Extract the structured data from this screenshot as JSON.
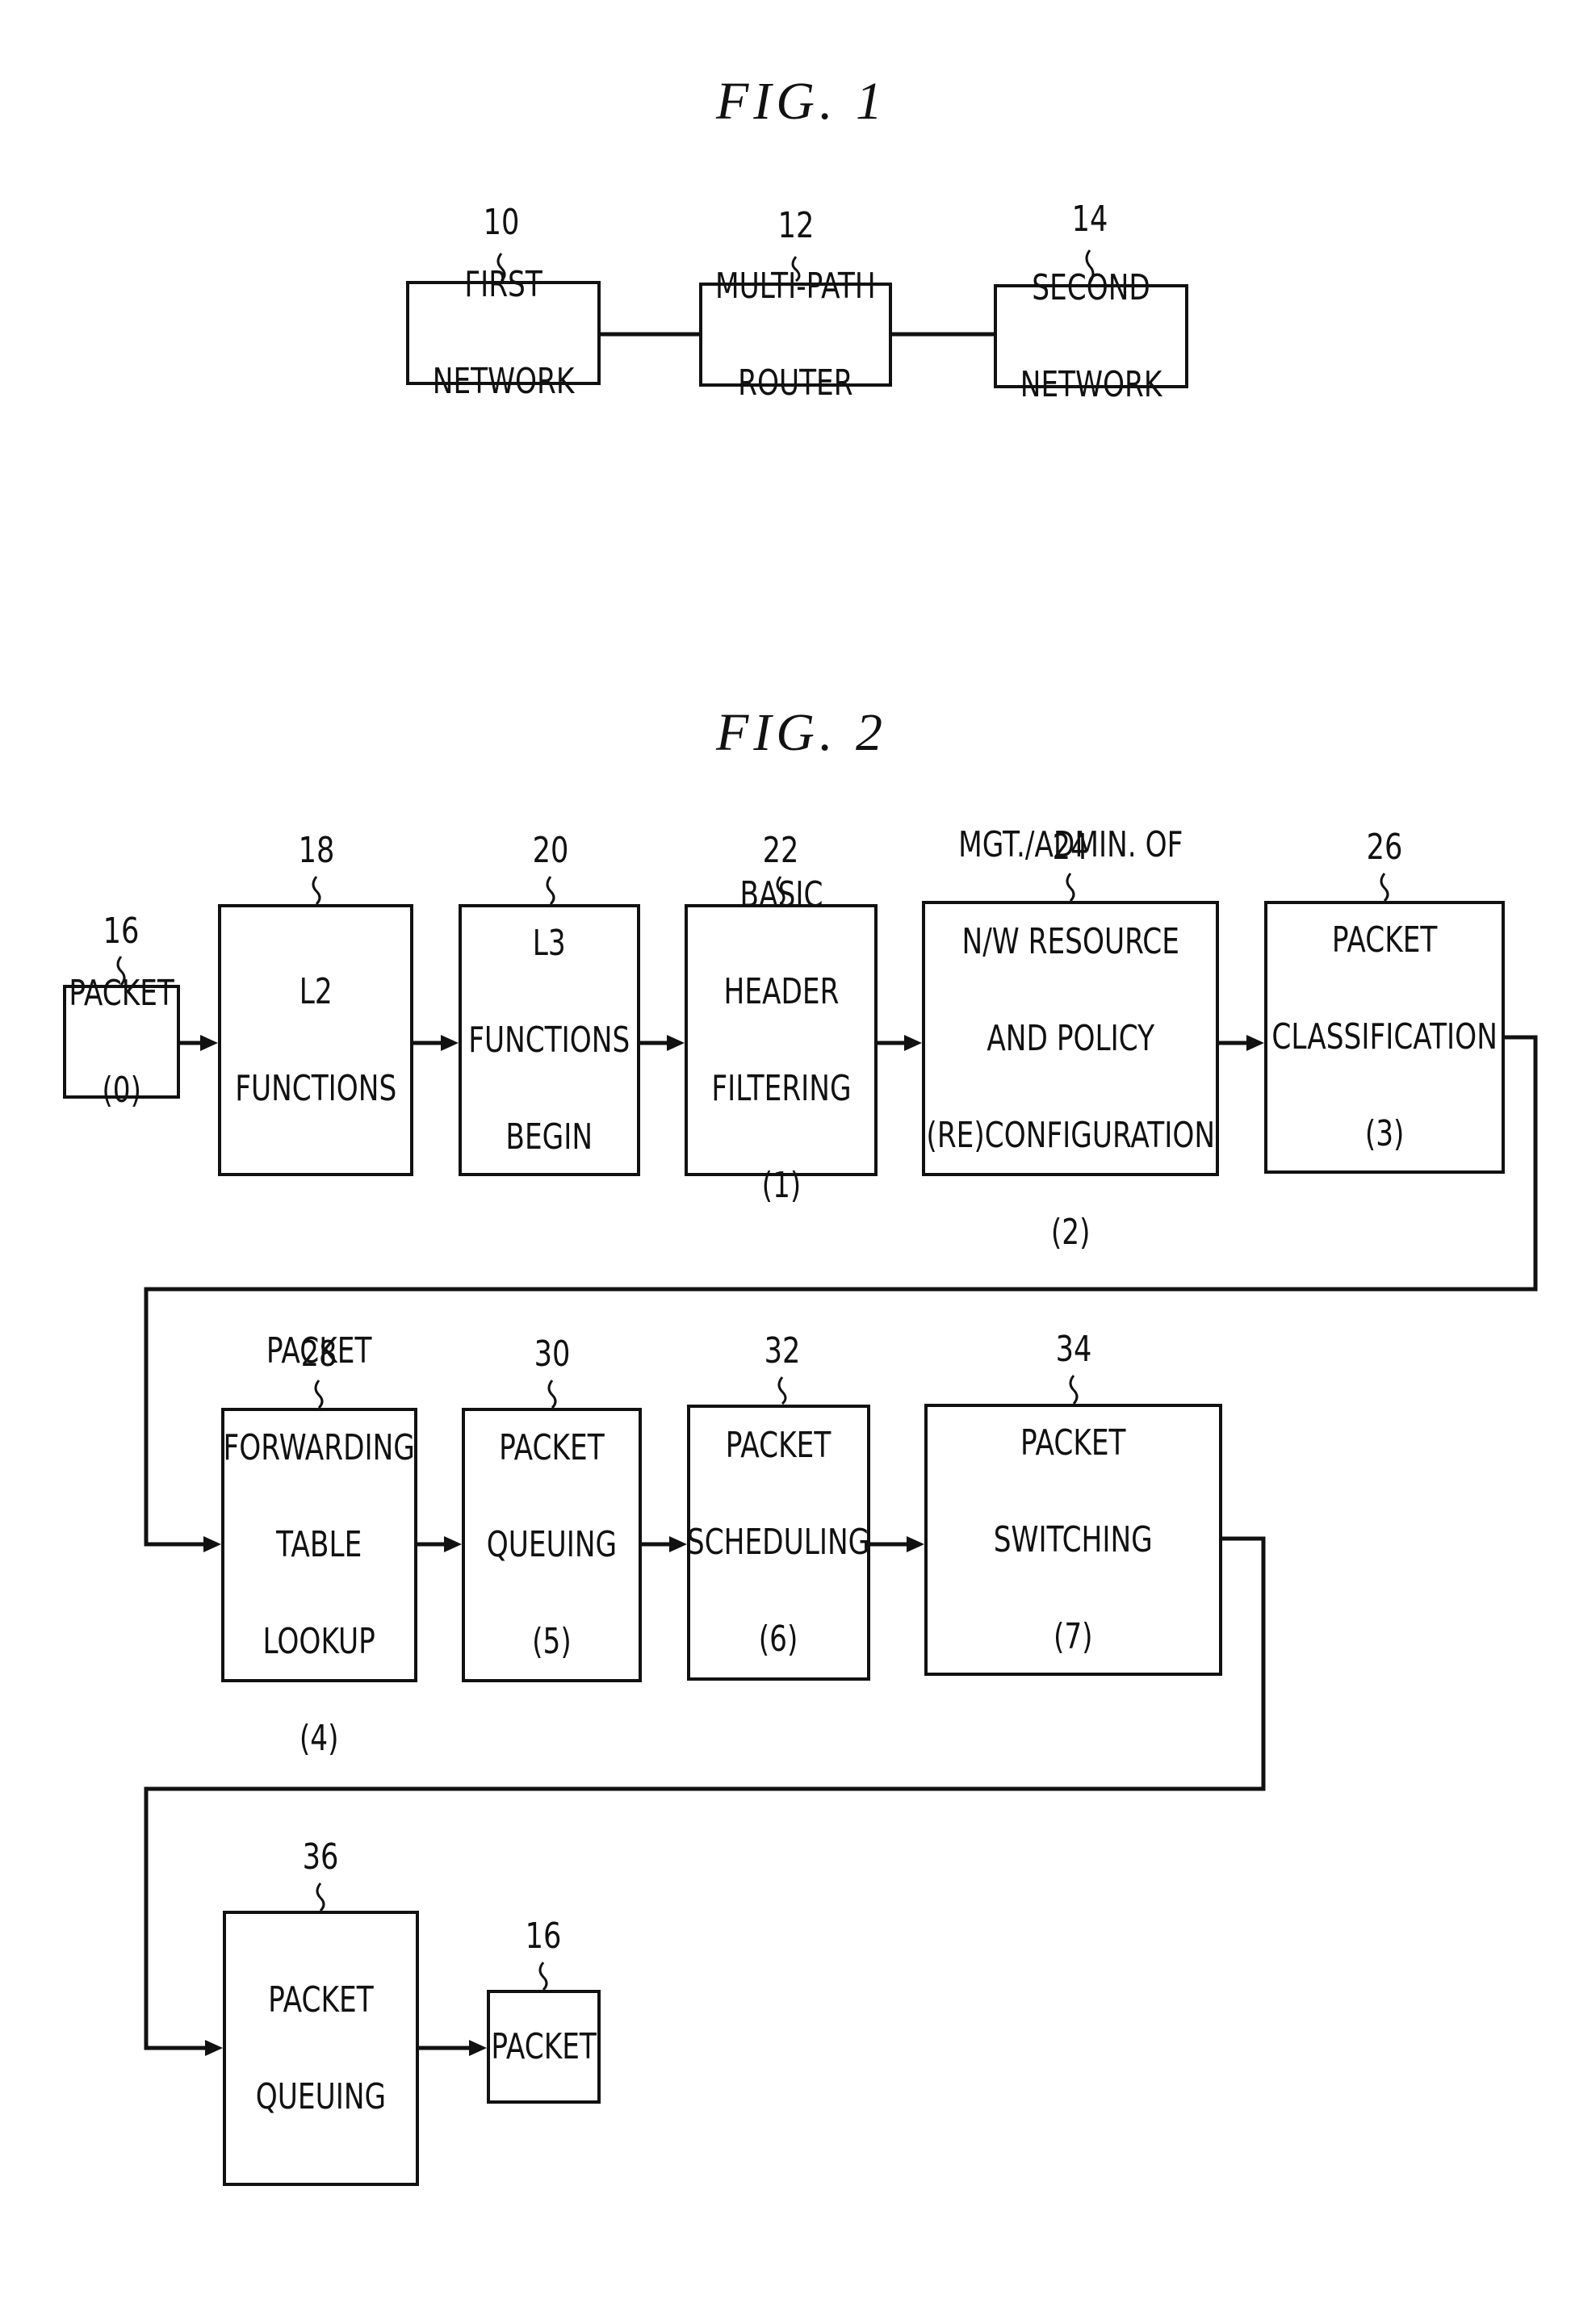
{
  "figures": [
    {
      "title": "FIG. 1",
      "blocks": [
        {
          "ref": "10",
          "lines": [
            "FIRST",
            "NETWORK"
          ]
        },
        {
          "ref": "12",
          "lines": [
            "MULTI-PATH",
            "ROUTER"
          ]
        },
        {
          "ref": "14",
          "lines": [
            "SECOND",
            "NETWORK"
          ]
        }
      ],
      "connections": [
        {
          "from": "10",
          "to": "12",
          "type": "line"
        },
        {
          "from": "12",
          "to": "14",
          "type": "line"
        }
      ]
    },
    {
      "title": "FIG. 2",
      "blocks": [
        {
          "ref": "16",
          "lines": [
            "PACKET",
            "(0)"
          ]
        },
        {
          "ref": "18",
          "lines": [
            "L2",
            "FUNCTIONS"
          ]
        },
        {
          "ref": "20",
          "lines": [
            "L3",
            "FUNCTIONS",
            "BEGIN"
          ]
        },
        {
          "ref": "22",
          "lines": [
            "BASIC",
            "HEADER",
            "FILTERING",
            "(1)"
          ]
        },
        {
          "ref": "24",
          "lines": [
            "MGT./ADMIN. OF",
            "N/W RESOURCE",
            "AND POLICY",
            "(RE)CONFIGURATION",
            "(2)"
          ]
        },
        {
          "ref": "26",
          "lines": [
            "PACKET",
            "CLASSIFICATION",
            "(3)"
          ]
        },
        {
          "ref": "28",
          "lines": [
            "PACKET",
            "FORWARDING",
            "TABLE",
            "LOOKUP",
            "(4)"
          ]
        },
        {
          "ref": "30",
          "lines": [
            "PACKET",
            "QUEUING",
            "(5)"
          ]
        },
        {
          "ref": "32",
          "lines": [
            "PACKET",
            "SCHEDULING",
            "(6)"
          ]
        },
        {
          "ref": "34",
          "lines": [
            "PACKET",
            "SWITCHING",
            "(7)"
          ]
        },
        {
          "ref": "36",
          "lines": [
            "PACKET",
            "QUEUING"
          ]
        },
        {
          "ref": "16",
          "lines": [
            "PACKET"
          ]
        }
      ],
      "connections": [
        {
          "from": "16",
          "to": "18",
          "type": "arrow"
        },
        {
          "from": "18",
          "to": "20",
          "type": "arrow"
        },
        {
          "from": "20",
          "to": "22",
          "type": "arrow"
        },
        {
          "from": "22",
          "to": "24",
          "type": "arrow"
        },
        {
          "from": "24",
          "to": "26",
          "type": "arrow"
        },
        {
          "from": "26",
          "to": "28",
          "type": "arrow"
        },
        {
          "from": "28",
          "to": "30",
          "type": "arrow"
        },
        {
          "from": "30",
          "to": "32",
          "type": "arrow"
        },
        {
          "from": "32",
          "to": "34",
          "type": "arrow"
        },
        {
          "from": "34",
          "to": "36",
          "type": "arrow"
        },
        {
          "from": "36",
          "to": "16",
          "type": "arrow"
        }
      ]
    }
  ]
}
